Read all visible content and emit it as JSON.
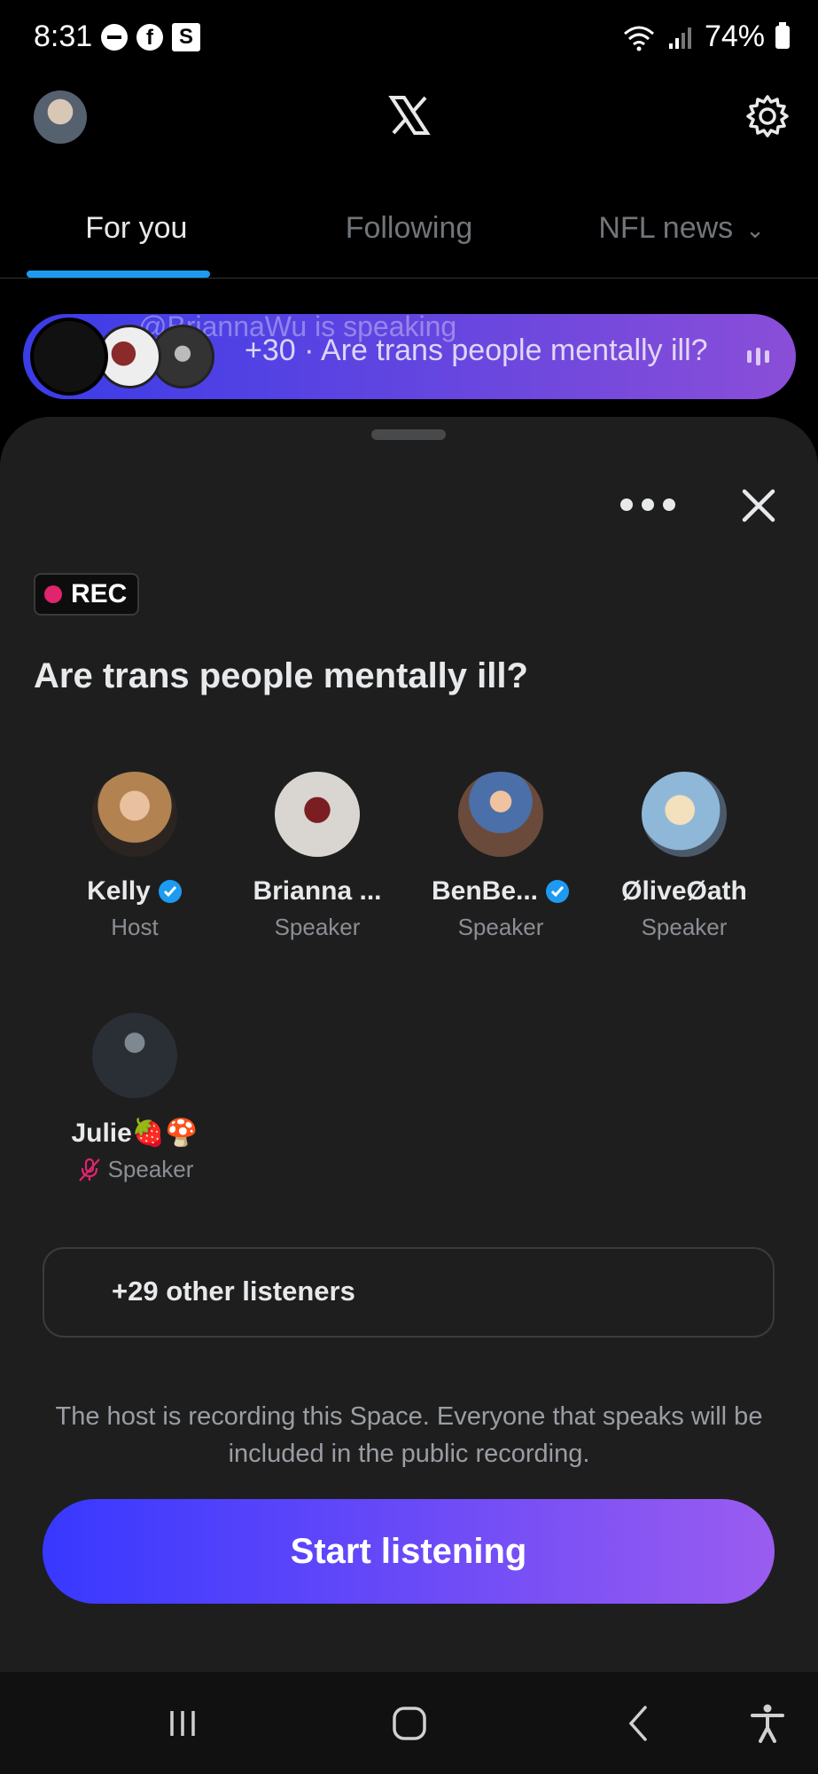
{
  "status_bar": {
    "time": "8:31",
    "battery": "74%",
    "icons": [
      "dnd-icon",
      "facebook-icon",
      "s-app-icon",
      "wifi-icon",
      "signal-icon",
      "battery-icon"
    ]
  },
  "header": {
    "logo": "X"
  },
  "tabs": [
    {
      "label": "For you",
      "active": true
    },
    {
      "label": "Following",
      "active": false
    },
    {
      "label": "NFL news",
      "active": false
    }
  ],
  "space_pill": {
    "ghost_text": "@BriannaWu is speaking",
    "text": "+30 · Are trans people mentally ill?"
  },
  "space": {
    "rec_label": "REC",
    "title": "Are trans people mentally ill?",
    "participants": [
      {
        "name": "Kelly",
        "role": "Host",
        "verified": true,
        "muted": false
      },
      {
        "name": "Brianna ...",
        "role": "Speaker",
        "verified": false,
        "muted": false
      },
      {
        "name": "BenBe...",
        "role": "Speaker",
        "verified": true,
        "muted": false
      },
      {
        "name": "ØliveØath",
        "role": "Speaker",
        "verified": false,
        "muted": false
      },
      {
        "name": "Julie🍓🍄",
        "role": "Speaker",
        "verified": false,
        "muted": true
      }
    ],
    "listeners_label": "+29 other listeners",
    "notice": "The host is recording this Space. Everyone that speaks will be included in the public recording.",
    "start_button": "Start listening"
  },
  "colors": {
    "accent": "#1d9bf0",
    "rec": "#e0246e",
    "gradient_start": "#3838ff",
    "gradient_end": "#9a5cf0"
  }
}
